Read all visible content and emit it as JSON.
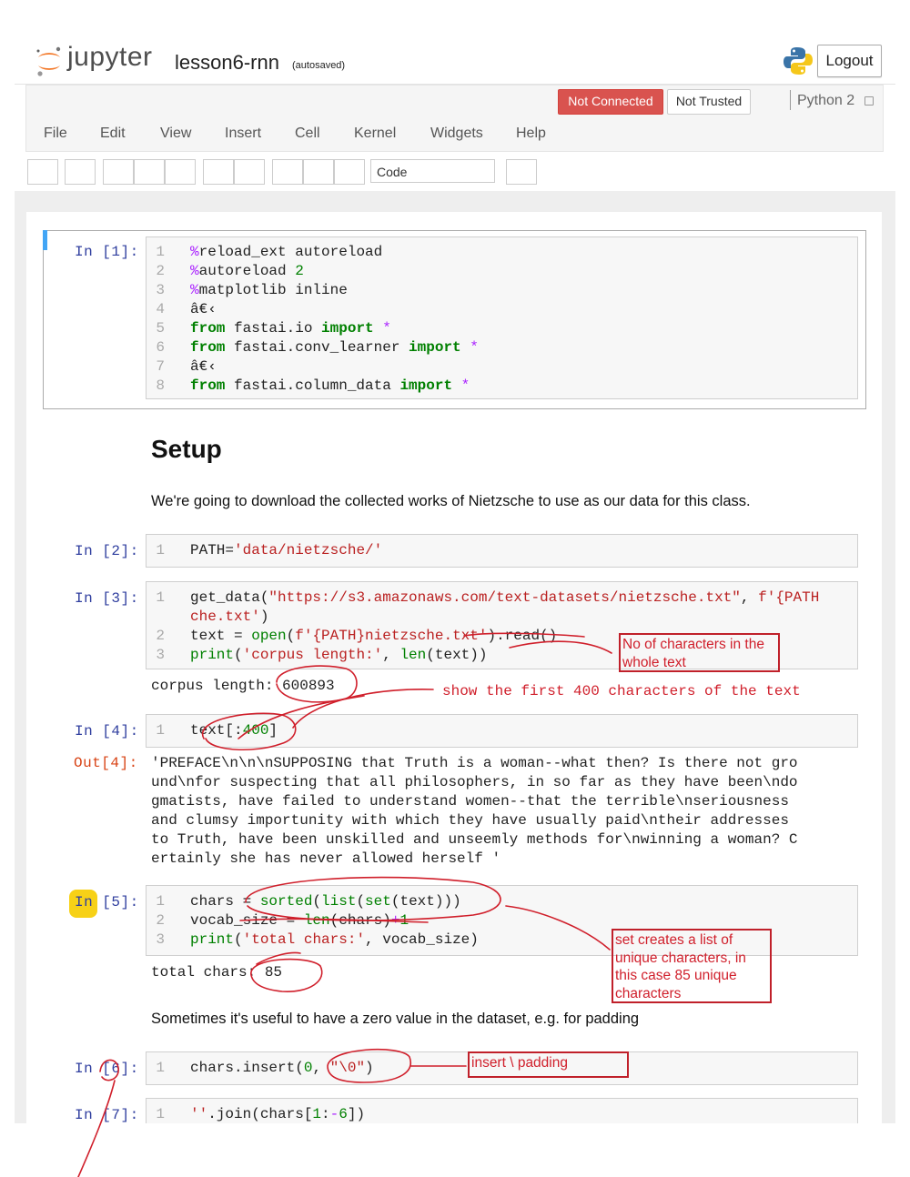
{
  "header": {
    "logo_text": "jupyter",
    "notebook_title": "lesson6-rnn",
    "autosave_status": "(autosaved)",
    "logout_label": "Logout"
  },
  "status": {
    "connection": "Not Connected",
    "trust": "Not Trusted",
    "kernel": "Python 2"
  },
  "menu": [
    "File",
    "Edit",
    "View",
    "Insert",
    "Cell",
    "Kernel",
    "Widgets",
    "Help"
  ],
  "toolbar": {
    "cell_type": "Code"
  },
  "cells": {
    "c1": {
      "prompt": "In [1]:",
      "lines": [
        {
          "n": "1",
          "t": "%reload_ext autoreload"
        },
        {
          "n": "2",
          "t": "%autoreload 2"
        },
        {
          "n": "3",
          "t": "%matplotlib inline"
        },
        {
          "n": "4",
          "t": "â€‹"
        },
        {
          "n": "5",
          "t": "from fastai.io import *"
        },
        {
          "n": "6",
          "t": "from fastai.conv_learner import *"
        },
        {
          "n": "7",
          "t": "â€‹"
        },
        {
          "n": "8",
          "t": "from fastai.column_data import *"
        }
      ]
    },
    "md1": {
      "heading": "Setup",
      "paragraph": "We're going to download the collected works of Nietzsche to use as our data for this class."
    },
    "c2": {
      "prompt": "In [2]:",
      "lines": [
        {
          "n": "1",
          "t": "PATH='data/nietzsche/'"
        }
      ]
    },
    "c3": {
      "prompt": "In [3]:",
      "lines": [
        {
          "n": "1",
          "t": "get_data(\"https://s3.amazonaws.com/text-datasets/nietzsche.txt\", f'{PATH"
        },
        {
          "n": "",
          "t": "che.txt')"
        },
        {
          "n": "2",
          "t": "text = open(f'{PATH}nietzsche.txt').read()"
        },
        {
          "n": "3",
          "t": "print('corpus length:', len(text))"
        }
      ],
      "output": "corpus length: 600893"
    },
    "c4": {
      "prompt": "In [4]:",
      "lines": [
        {
          "n": "1",
          "t": "text[:400]"
        }
      ],
      "out_prompt": "Out[4]:",
      "output_lines": [
        "'PREFACE\\n\\n\\nSUPPOSING that Truth is a woman--what then? Is there not gro",
        "und\\nfor suspecting that all philosophers, in so far as they have been\\ndo",
        "gmatists, have failed to understand women--that the terrible\\nseriousness",
        "and clumsy importunity with which they have usually paid\\ntheir addresses",
        "to Truth, have been unskilled and unseemly methods for\\nwinning a woman? C",
        "ertainly she has never allowed herself '"
      ]
    },
    "c5": {
      "prompt_in": "In",
      "prompt_rest": " [5]:",
      "lines": [
        {
          "n": "1",
          "t": "chars = sorted(list(set(text)))"
        },
        {
          "n": "2",
          "t": "vocab_size = len(chars)+1"
        },
        {
          "n": "3",
          "t": "print('total chars:', vocab_size)"
        }
      ],
      "output": "total chars: 85"
    },
    "md2": {
      "paragraph": "Sometimes it's useful to have a zero value in the dataset, e.g. for padding"
    },
    "c6": {
      "prompt": "In [6]:",
      "lines": [
        {
          "n": "1",
          "t": "chars.insert(0, \"\\0\")"
        }
      ]
    },
    "c7": {
      "prompt": "In [7]:",
      "lines": [
        {
          "n": "1",
          "t": "''.join(chars[1:-6])"
        }
      ]
    }
  },
  "annotations": {
    "corpus_note": "No of characters in the whole text",
    "first400_note": "show the first 400 characters of the text",
    "set_note": "set creates a list of unique characters, in this case 85 unique characters",
    "insert_note": "insert \\ padding"
  },
  "colors": {
    "not_connected_bg": "#d9534f",
    "prompt_in": "#303f9f",
    "prompt_out": "#d84315",
    "keyword": "#008000",
    "string": "#ba2121",
    "magic": "#aa22ff",
    "annotation_ink": "#d01f2b",
    "selected_cell_bar": "#42a5f5",
    "highlight": "#f7d117"
  }
}
